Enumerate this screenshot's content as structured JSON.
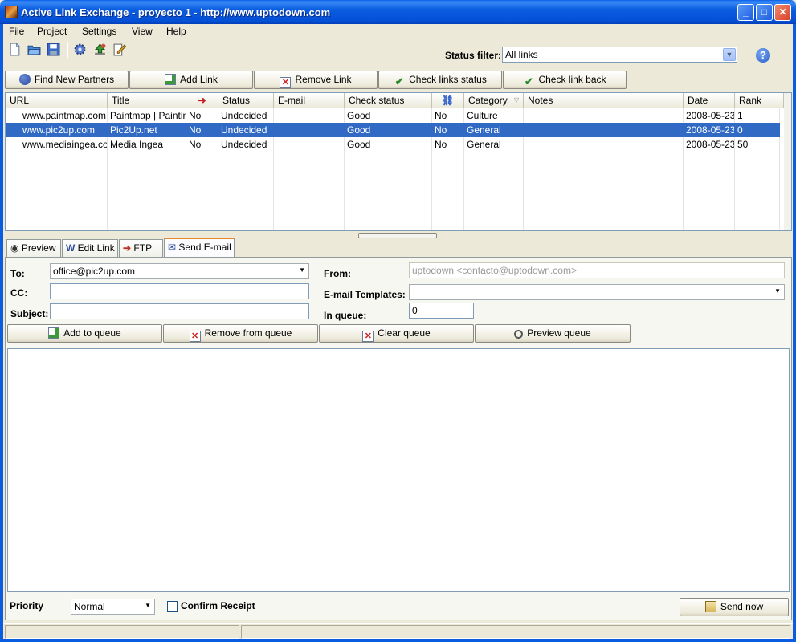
{
  "window": {
    "title": "Active Link Exchange - proyecto 1 - http://www.uptodown.com"
  },
  "menu": [
    "File",
    "Project",
    "Settings",
    "View",
    "Help"
  ],
  "toolbar": {
    "icons": [
      "new-file-icon",
      "open-folder-icon",
      "save-disk-icon",
      "settings-gear-icon",
      "upload-icon",
      "edit-document-icon"
    ],
    "status_filter_label": "Status filter:",
    "status_filter_value": "All links"
  },
  "actions": {
    "find_partners": "Find New Partners",
    "add_link": "Add Link",
    "remove_link": "Remove Link",
    "check_status": "Check links status",
    "check_back": "Check link back"
  },
  "table": {
    "columns": [
      "URL",
      "Title",
      "",
      "Status",
      "E-mail",
      "Check status",
      "",
      "Category",
      "Notes",
      "Date",
      "Rank"
    ],
    "rows": [
      [
        "www.paintmap.com",
        "Paintmap | Paintin...",
        "No",
        "Undecided",
        "",
        "Good",
        "No",
        "Culture",
        "",
        "2008-05-23",
        "1"
      ],
      [
        "www.pic2up.com",
        "Pic2Up.net",
        "No",
        "Undecided",
        "",
        "Good",
        "No",
        "General",
        "",
        "2008-05-23",
        "0"
      ],
      [
        "www.mediaingea.com",
        "Media Ingea",
        "No",
        "Undecided",
        "",
        "Good",
        "No",
        "General",
        "",
        "2008-05-23",
        "50"
      ]
    ],
    "selected_row": 1
  },
  "tabs": [
    "Preview",
    "Edit Link",
    "FTP",
    "Send E-mail"
  ],
  "active_tab": "Send E-mail",
  "email": {
    "to_label": "To:",
    "to_value": "office@pic2up.com",
    "cc_label": "CC:",
    "cc_value": "",
    "subject_label": "Subject:",
    "subject_value": "",
    "from_label": "From:",
    "from_value": "uptodown <contacto@uptodown.com>",
    "templates_label": "E-mail Templates:",
    "templates_value": "",
    "queue_label": "In queue:",
    "queue_value": "0",
    "add_queue": "Add to queue",
    "remove_queue": "Remove from queue",
    "clear_queue": "Clear queue",
    "preview_queue": "Preview queue",
    "body": "",
    "priority_label": "Priority",
    "priority_value": "Normal",
    "confirm_label": "Confirm Receipt",
    "send_now": "Send now"
  }
}
